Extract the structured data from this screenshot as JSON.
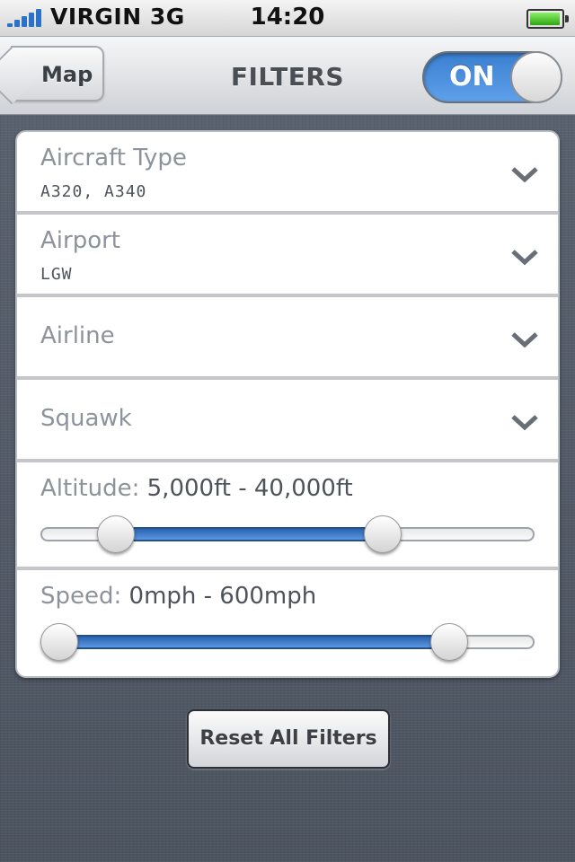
{
  "status_bar": {
    "carrier": "VIRGIN 3G",
    "time": "14:20"
  },
  "nav": {
    "back_label": "Map",
    "title": "FILTERS",
    "toggle_label": "ON"
  },
  "filters": [
    {
      "title": "Aircraft Type",
      "value": "A320, A340"
    },
    {
      "title": "Airport",
      "value": "LGW"
    },
    {
      "title": "Airline",
      "value": ""
    },
    {
      "title": "Squawk",
      "value": ""
    }
  ],
  "altitude": {
    "label": "Altitude:",
    "range": "5,000ft - 40,000ft",
    "low_fraction": 0.15,
    "high_fraction": 0.695
  },
  "speed": {
    "label": "Speed:",
    "range": "0mph - 600mph",
    "low_fraction": 0.035,
    "high_fraction": 0.83
  },
  "reset_label": "Reset All Filters",
  "colors": {
    "accent": "#3a7fd0",
    "fill": "#2a62ad"
  },
  "icons": {
    "dropdown": "chevron-down-icon",
    "back": "back-arrow-icon"
  }
}
